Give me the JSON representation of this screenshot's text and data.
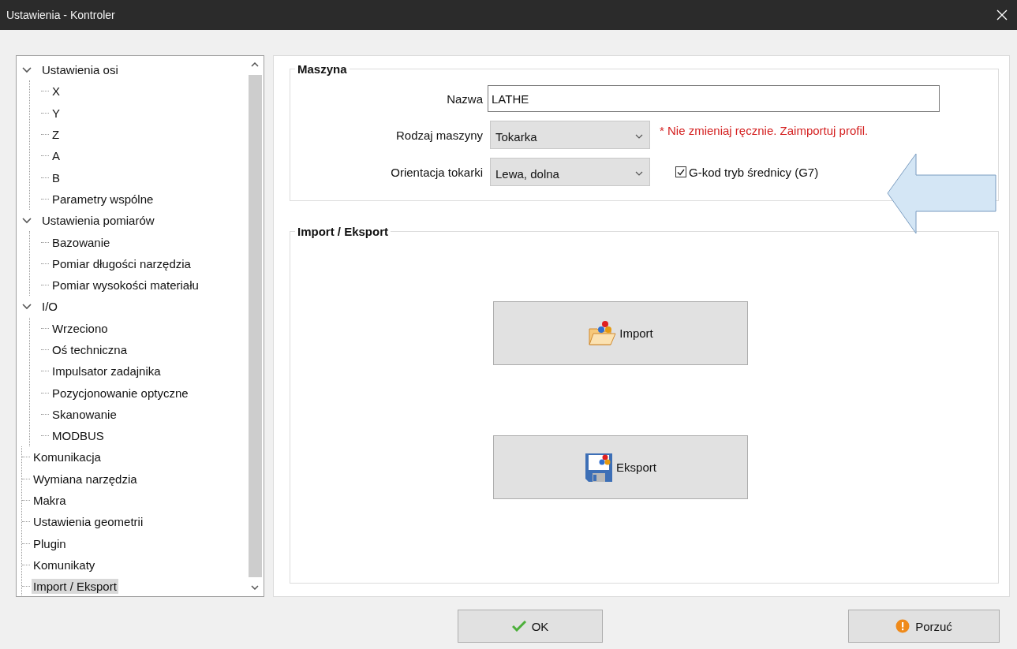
{
  "window": {
    "title": "Ustawienia - Kontroler"
  },
  "tree": [
    {
      "label": "Ustawienia osi",
      "expanded": true,
      "selected": false,
      "children": [
        {
          "label": "X",
          "selected": false
        },
        {
          "label": "Y",
          "selected": false
        },
        {
          "label": "Z",
          "selected": false
        },
        {
          "label": "A",
          "selected": false
        },
        {
          "label": "B",
          "selected": false
        },
        {
          "label": "Parametry wspólne",
          "selected": false
        }
      ]
    },
    {
      "label": "Ustawienia pomiarów",
      "expanded": true,
      "selected": false,
      "children": [
        {
          "label": "Bazowanie",
          "selected": false
        },
        {
          "label": "Pomiar długości narzędzia",
          "selected": false
        },
        {
          "label": "Pomiar wysokości materiału",
          "selected": false
        }
      ]
    },
    {
      "label": "I/O",
      "expanded": true,
      "selected": false,
      "children": [
        {
          "label": "Wrzeciono",
          "selected": false
        },
        {
          "label": "Oś techniczna",
          "selected": false
        },
        {
          "label": "Impulsator zadajnika",
          "selected": false
        },
        {
          "label": "Pozycjonowanie optyczne",
          "selected": false
        },
        {
          "label": "Skanowanie",
          "selected": false
        },
        {
          "label": "MODBUS",
          "selected": false
        }
      ]
    },
    {
      "label": "Komunikacja",
      "selected": false
    },
    {
      "label": "Wymiana narzędzia",
      "selected": false
    },
    {
      "label": "Makra",
      "selected": false
    },
    {
      "label": "Ustawienia geometrii",
      "selected": false
    },
    {
      "label": "Plugin",
      "selected": false
    },
    {
      "label": "Komunikaty",
      "selected": false
    },
    {
      "label": "Import / Eksport",
      "selected": true
    }
  ],
  "machine": {
    "title": "Maszyna",
    "name_label": "Nazwa",
    "name_value": "LATHE",
    "type_label": "Rodzaj maszyny",
    "type_value": "Tokarka",
    "warning": "* Nie zmieniaj ręcznie. Zaimportuj profil.",
    "orientation_label": "Orientacja tokarki",
    "orientation_value": "Lewa, dolna",
    "diameter_mode": {
      "label": "G-kod tryb średnicy (G7)",
      "checked": true
    }
  },
  "import_export": {
    "title": "Import / Eksport",
    "buttons": [
      {
        "kind": "import",
        "label": "Import"
      },
      {
        "kind": "export",
        "label": "Eksport"
      }
    ]
  },
  "footer_buttons": [
    {
      "kind": "ok",
      "label": "OK"
    },
    {
      "kind": "cancel",
      "label": "Porzuć"
    }
  ]
}
